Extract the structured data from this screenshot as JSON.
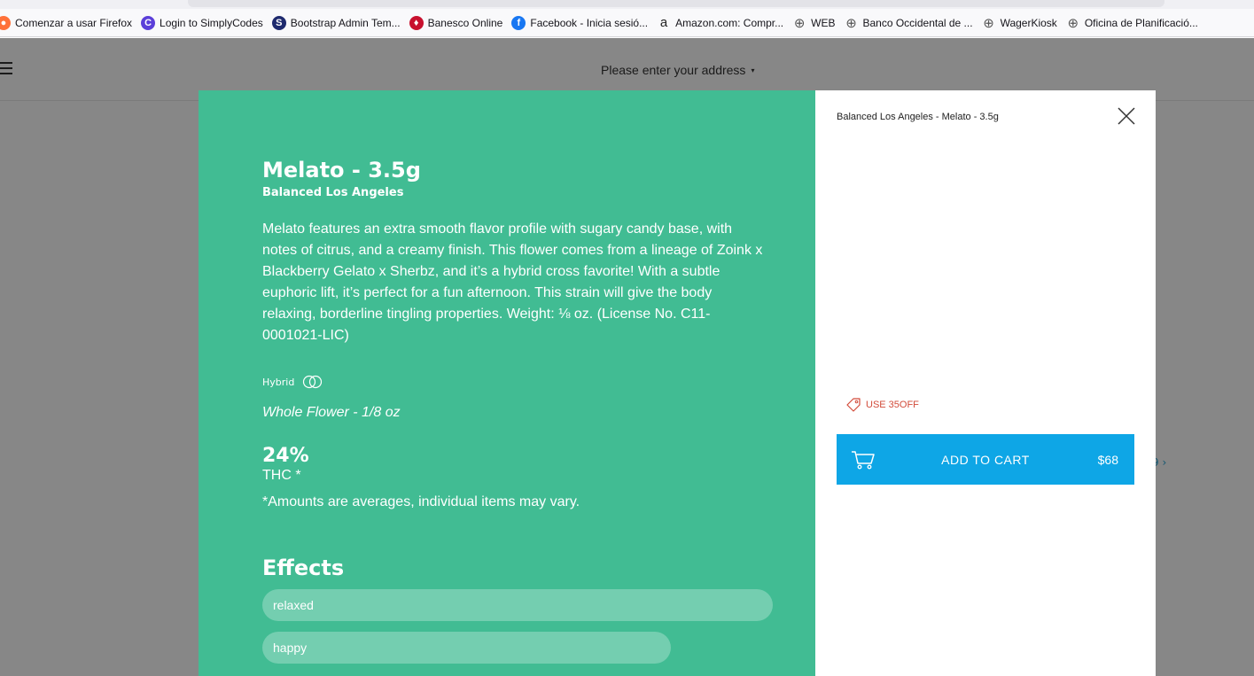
{
  "browser": {
    "bookmarks": [
      {
        "label": "Comenzar a usar Firefox",
        "icon": "firefox-icon",
        "color": "#ff7139"
      },
      {
        "label": "Login to SimplyCodes",
        "icon": "simplycodes-icon",
        "color": "#5b3fd9"
      },
      {
        "label": "Bootstrap Admin Tem...",
        "icon": "bootstrap-s-icon",
        "color": "#1e2a6e"
      },
      {
        "label": "Banesco Online",
        "icon": "banesco-icon",
        "color": "#c8102e"
      },
      {
        "label": "Facebook - Inicia sesió...",
        "icon": "facebook-icon",
        "color": "#1877f2"
      },
      {
        "label": "Amazon.com: Compr...",
        "icon": "amazon-icon",
        "color": "#222222"
      },
      {
        "label": "WEB",
        "icon": "globe-icon",
        "color": "#555555"
      },
      {
        "label": "Banco Occidental de ...",
        "icon": "globe-icon",
        "color": "#555555"
      },
      {
        "label": "WagerKiosk",
        "icon": "globe-icon",
        "color": "#555555"
      },
      {
        "label": "Oficina de Planificació...",
        "icon": "globe-icon",
        "color": "#555555"
      }
    ]
  },
  "header": {
    "address_placeholder": "Please enter your address",
    "caret": "▾"
  },
  "background": {
    "partial_link": "9 ›"
  },
  "product": {
    "title": "Melato - 3.5g",
    "brand": "Balanced Los Angeles",
    "description": "Melato features an extra smooth flavor profile with sugary candy base, with notes of citrus, and a creamy finish. This flower comes from a lineage of Zoink x Blackberry Gelato x Sherbz, and it’s a hybrid cross favorite! With a subtle euphoric lift, it’s perfect for a fun afternoon. This strain will give the body relaxing, borderline tingling properties. Weight: ⅛ oz. (License No. C11-0001021-LIC)",
    "strain_type": "Hybrid",
    "category": "Whole Flower - 1/8 oz",
    "thc_value": "24%",
    "thc_label": "THC *",
    "disclaimer": "*Amounts are averages, individual items may vary.",
    "effects_title": "Effects",
    "effects": [
      {
        "label": "relaxed",
        "level": 1.0
      },
      {
        "label": "happy",
        "level": 0.8
      }
    ]
  },
  "sidebar": {
    "breadcrumb": "Balanced Los Angeles - Melato - 3.5g",
    "promo": "USE 35OFF",
    "add_to_cart_label": "ADD TO CART",
    "price": "$68"
  },
  "colors": {
    "panel_green": "#41bc93",
    "cart_blue": "#0ea6e6",
    "promo_red": "#d24b3a"
  }
}
